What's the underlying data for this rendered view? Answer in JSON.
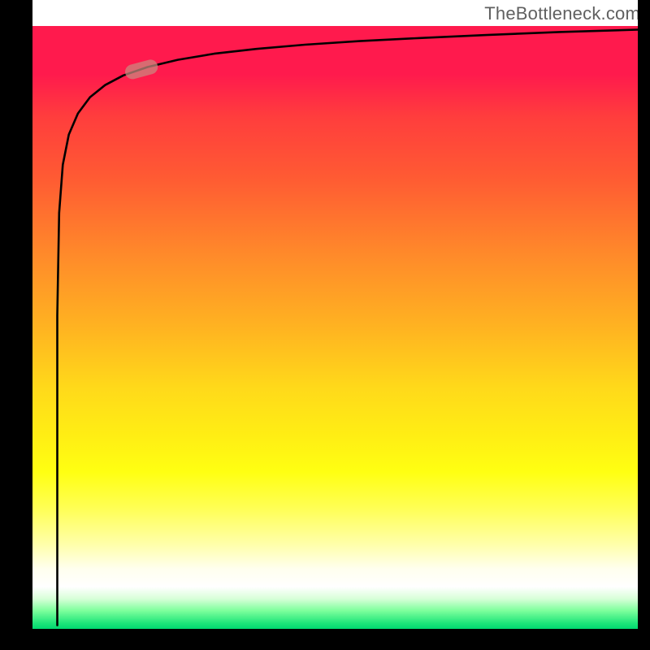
{
  "attribution_text": "TheBottleneck.com",
  "chart_data": {
    "type": "line",
    "title": "",
    "xlabel": "",
    "ylabel": "",
    "xlim": [
      0,
      1
    ],
    "ylim": [
      0,
      1
    ],
    "curve": [
      {
        "x": 0.041,
        "y": 0.006
      },
      {
        "x": 0.041,
        "y": 0.52
      },
      {
        "x": 0.044,
        "y": 0.69
      },
      {
        "x": 0.05,
        "y": 0.77
      },
      {
        "x": 0.06,
        "y": 0.82
      },
      {
        "x": 0.075,
        "y": 0.855
      },
      {
        "x": 0.095,
        "y": 0.882
      },
      {
        "x": 0.12,
        "y": 0.902
      },
      {
        "x": 0.15,
        "y": 0.918
      },
      {
        "x": 0.19,
        "y": 0.932
      },
      {
        "x": 0.24,
        "y": 0.944
      },
      {
        "x": 0.3,
        "y": 0.954
      },
      {
        "x": 0.37,
        "y": 0.962
      },
      {
        "x": 0.45,
        "y": 0.969
      },
      {
        "x": 0.54,
        "y": 0.975
      },
      {
        "x": 0.64,
        "y": 0.98
      },
      {
        "x": 0.75,
        "y": 0.985
      },
      {
        "x": 0.87,
        "y": 0.99
      },
      {
        "x": 1.0,
        "y": 0.994
      }
    ],
    "marker": {
      "x": 0.18,
      "y": 0.928,
      "length": 0.055,
      "angle_deg": 15
    }
  }
}
